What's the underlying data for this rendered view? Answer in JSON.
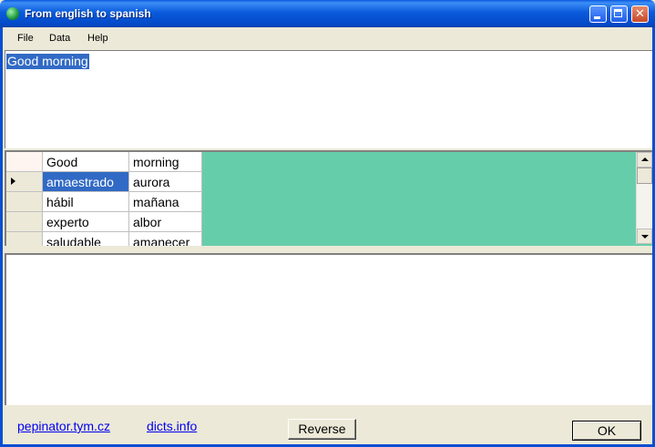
{
  "window": {
    "title": "From english to spanish",
    "buttons": {
      "minimize": "",
      "maximize": "",
      "close": "✕"
    }
  },
  "menu": {
    "items": [
      "File",
      "Data",
      "Help"
    ]
  },
  "input": {
    "text": "Good morning"
  },
  "grid": {
    "columns": [
      "Good",
      "morning"
    ],
    "rows": [
      [
        "amaestrado",
        "aurora"
      ],
      [
        "hábil",
        "mañana"
      ],
      [
        "experto",
        "albor"
      ],
      [
        "saludable",
        "amanecer"
      ]
    ],
    "selected_cell": "amaestrado",
    "background_color": "#66cdaa"
  },
  "output": {
    "text": ""
  },
  "footer": {
    "links": [
      "pepinator.tym.cz",
      "dicts.info"
    ],
    "reverse_label": "Reverse",
    "ok_label": "OK"
  }
}
